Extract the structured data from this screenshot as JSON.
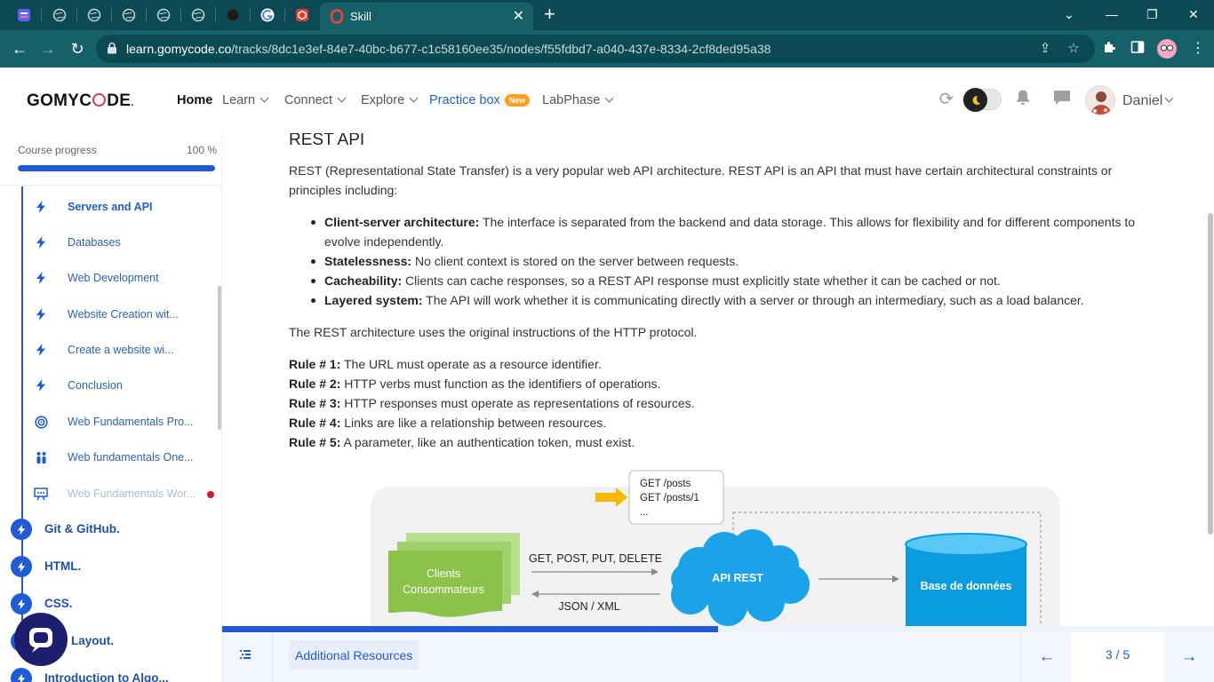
{
  "browser": {
    "tab_title": "Skill",
    "url_domain": "learn.gomycode.co",
    "url_path": "/tracks/8dc1e3ef-84e7-40bc-b677-c1c58160ee35/nodes/f55fdbd7-a040-437e-8334-2cf8ded95a38"
  },
  "header": {
    "logo": {
      "before": "GOMYC",
      "after": "DE",
      "mark": "."
    },
    "nav": [
      {
        "label": "Home"
      },
      {
        "label": "Learn"
      },
      {
        "label": "Connect"
      },
      {
        "label": "Explore"
      },
      {
        "label": "Practice box",
        "badge": "New"
      },
      {
        "label": "LabPhase"
      }
    ],
    "user_name": "Daniel"
  },
  "sidebar": {
    "progress_label": "Course progress",
    "progress_value": "100 %",
    "progress_fraction": 1.0,
    "items": [
      {
        "label": "Servers and API",
        "icon": "bolt-icon",
        "active": true
      },
      {
        "label": "Databases",
        "icon": "bolt-icon"
      },
      {
        "label": "Web Development",
        "icon": "bolt-icon"
      },
      {
        "label": "Website Creation wit...",
        "icon": "bolt-icon"
      },
      {
        "label": "Create a website wi...",
        "icon": "bolt-icon"
      },
      {
        "label": "Conclusion",
        "icon": "bolt-icon"
      },
      {
        "label": "Web Fundamentals Pro...",
        "icon": "target-icon"
      },
      {
        "label": "Web fundamentals One...",
        "icon": "people-icon"
      },
      {
        "label": "Web Fundamentals Wor...",
        "icon": "presentation-icon",
        "locked": true
      }
    ],
    "chapters": [
      {
        "label": "Git & GitHub."
      },
      {
        "label": "HTML."
      },
      {
        "label": "CSS."
      },
      {
        "label": "Layout."
      },
      {
        "label": "Introduction to Algo..."
      }
    ]
  },
  "content": {
    "title": "REST API",
    "intro": "REST (Representational State Transfer) is a very popular web API architecture. REST API is an API that must have certain architectural constraints or principles including:",
    "bullets": [
      {
        "term": "Client-server architecture:",
        "text": " The interface is separated from the backend and data storage. This allows for flexibility and for different components to evolve independently."
      },
      {
        "term": "Statelessness:",
        "text": " No client context is stored on the server between requests."
      },
      {
        "term": "Cacheability:",
        "text": " Clients can cache responses, so a REST API response must explicitly state whether it can be cached or not."
      },
      {
        "term": "Layered system:",
        "text": " The API will work whether it is communicating directly with a server or through an intermediary, such as a load balancer."
      }
    ],
    "http_note": "The REST architecture uses the original instructions of the HTTP protocol.",
    "rules": [
      {
        "term": "Rule # 1:",
        "text": " The URL must operate as a resource identifier."
      },
      {
        "term": "Rule # 2:",
        "text": " HTTP verbs must function as the identifiers of operations."
      },
      {
        "term": "Rule # 3:",
        "text": " HTTP responses must operate as representations of resources."
      },
      {
        "term": "Rule # 4:",
        "text": " Links are like a relationship between resources."
      },
      {
        "term": "Rule # 5:",
        "text": " A parameter, like an authentication token, must exist."
      }
    ],
    "diagram": {
      "callout_lines": [
        "GET /posts",
        "GET /posts/1",
        "..."
      ],
      "clients_line1": "Clients",
      "clients_line2": "Consommateurs",
      "request_methods": "GET, POST, PUT, DELETE",
      "response_format": "JSON / XML",
      "api_label": "API REST",
      "db_label": "Base de données"
    }
  },
  "footer": {
    "resources_label": "Additional Resources",
    "page": "3 / 5",
    "progress_fraction": 0.5
  },
  "colors": {
    "accent": "#1f5bd6",
    "browser_frame": "#0b4a52",
    "browser_toolbar": "#166067",
    "diagram_green": "#8bc34a",
    "diagram_blue": "#1aa3e8",
    "new_badge": "#ff9f1c",
    "alert_dot": "#e0112b"
  }
}
